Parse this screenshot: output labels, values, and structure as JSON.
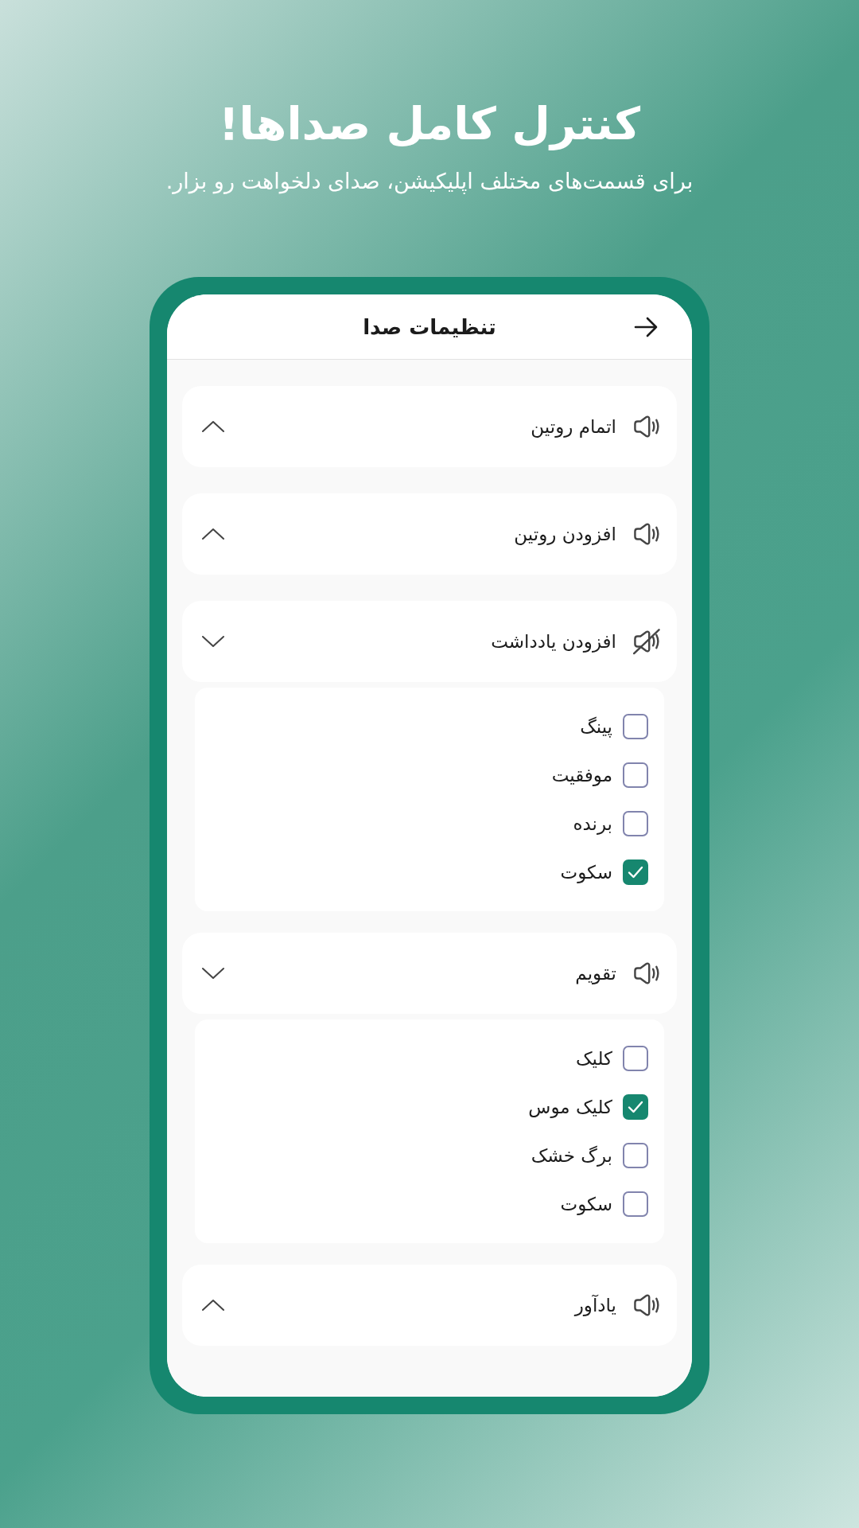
{
  "hero": {
    "title": "کنترل کامل صداها!",
    "subtitle": "برای قسمت‌های مختلف اپلیکیشن، صدای دلخواهت رو بزار."
  },
  "screen": {
    "title": "تنظیمات صدا"
  },
  "sound_groups": [
    {
      "label": "اتمام روتین",
      "muted": false,
      "expanded": false
    },
    {
      "label": "افزودن روتین",
      "muted": false,
      "expanded": false
    },
    {
      "label": "افزودن یادداشت",
      "muted": true,
      "expanded": true,
      "options": [
        {
          "label": "پینگ",
          "checked": false
        },
        {
          "label": "موفقیت",
          "checked": false
        },
        {
          "label": "برنده",
          "checked": false
        },
        {
          "label": "سکوت",
          "checked": true
        }
      ]
    },
    {
      "label": "تقویم",
      "muted": false,
      "expanded": true,
      "options": [
        {
          "label": "کلیک",
          "checked": false
        },
        {
          "label": "کلیک موس",
          "checked": true
        },
        {
          "label": "برگ خشک",
          "checked": false
        },
        {
          "label": "سکوت",
          "checked": false
        }
      ]
    },
    {
      "label": "یادآور",
      "muted": false,
      "expanded": false
    }
  ]
}
